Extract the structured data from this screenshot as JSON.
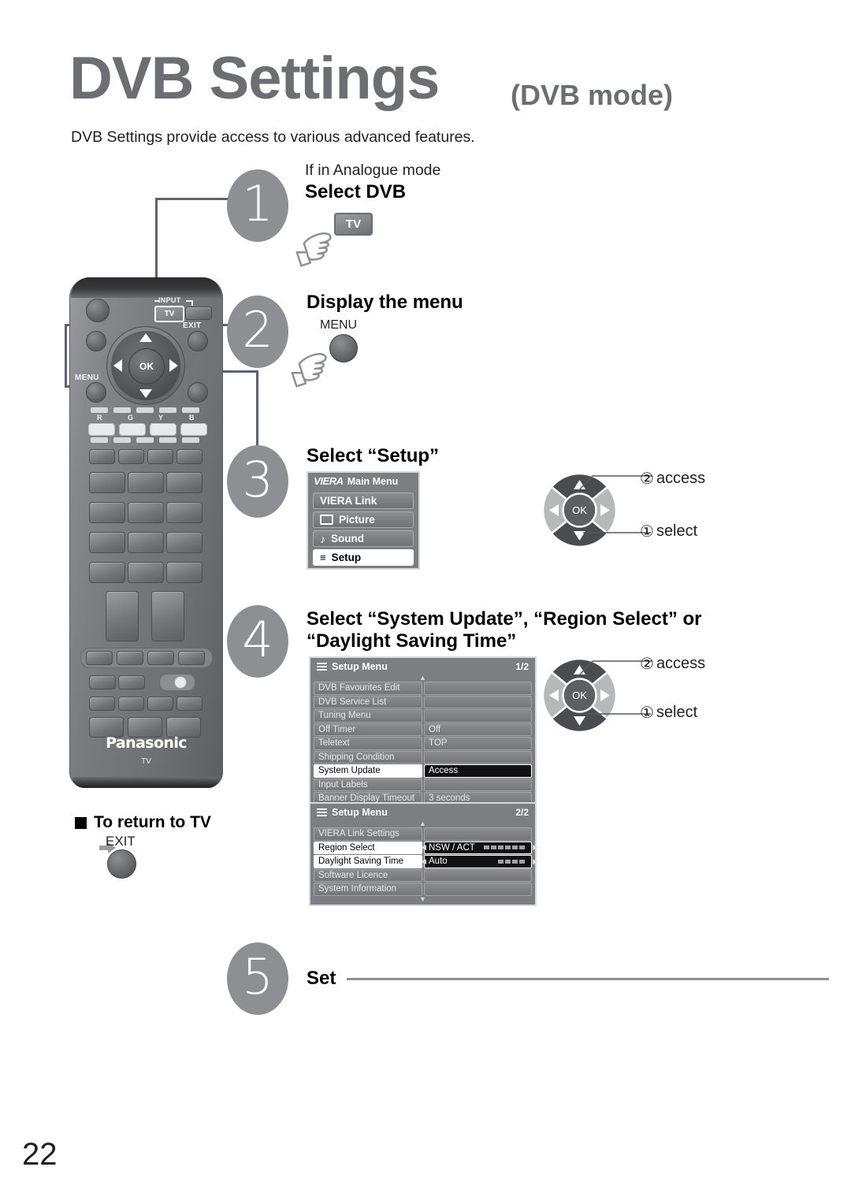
{
  "header": {
    "title": "DVB Settings",
    "subtitle": "(DVB mode)",
    "intro": "DVB Settings provide access to various advanced features."
  },
  "steps": [
    {
      "num": "1",
      "note": "If in Analogue mode",
      "heading": "Select DVB",
      "button_label": "TV"
    },
    {
      "num": "2",
      "note": "",
      "heading": "Display the menu",
      "button_label": "MENU"
    },
    {
      "num": "3",
      "note": "",
      "heading": "Select “Setup”"
    },
    {
      "num": "4",
      "note": "",
      "heading": "Select “System Update”, “Region Select” or “Daylight Saving Time”"
    },
    {
      "num": "5",
      "note": "",
      "heading": "Set"
    }
  ],
  "main_menu": {
    "brand": "VIERA",
    "title": "Main Menu",
    "items": [
      {
        "label": "VIERA Link",
        "icon": "",
        "selected": false
      },
      {
        "label": "Picture",
        "icon": "screen-icon",
        "selected": false
      },
      {
        "label": "Sound",
        "icon": "note-icon",
        "selected": false
      },
      {
        "label": "Setup",
        "icon": "list-icon",
        "selected": true
      }
    ]
  },
  "setup_menu_1": {
    "title": "Setup Menu",
    "page": "1/2",
    "rows": [
      {
        "label": "DVB Favourites Edit",
        "value": "",
        "state": "normal"
      },
      {
        "label": "DVB Service List",
        "value": "",
        "state": "normal"
      },
      {
        "label": "Tuning Menu",
        "value": "",
        "state": "normal"
      },
      {
        "label": "Off Timer",
        "value": "Off",
        "state": "normal"
      },
      {
        "label": "Teletext",
        "value": "TOP",
        "state": "normal"
      },
      {
        "label": "Shipping Condition",
        "value": "",
        "state": "normal"
      },
      {
        "label": "System Update",
        "value": "Access",
        "state": "highlight"
      },
      {
        "label": "Input Labels",
        "value": "",
        "state": "normal"
      },
      {
        "label": "Banner Display Timeout",
        "value": "3 seconds",
        "state": "normal"
      }
    ]
  },
  "setup_menu_2": {
    "title": "Setup Menu",
    "page": "2/2",
    "rows": [
      {
        "label": "VIERA Link Settings",
        "value": "",
        "state": "normal"
      },
      {
        "label": "Region Select",
        "value": "NSW / ACT",
        "state": "adjust",
        "segments": 6
      },
      {
        "label": "Daylight Saving Time",
        "value": "Auto",
        "state": "adjust",
        "segments": 4
      },
      {
        "label": "Software Licence",
        "value": "",
        "state": "normal"
      },
      {
        "label": "System Information",
        "value": "",
        "state": "normal"
      }
    ]
  },
  "navpads": [
    {
      "access_num": "②",
      "access_label": "access",
      "select_num": "①",
      "select_label": "select",
      "ok_label": "OK"
    },
    {
      "access_num": "②",
      "access_label": "access",
      "select_num": "①",
      "select_label": "select",
      "ok_label": "OK"
    }
  ],
  "remote": {
    "brand": "Panasonic",
    "mode_label": "TV",
    "labels": {
      "input": "INPUT",
      "tv": "TV",
      "exit": "EXIT",
      "menu": "MENU",
      "ok": "OK",
      "color_r": "R",
      "color_g": "G",
      "color_y": "Y",
      "color_b": "B"
    }
  },
  "return_to_tv": {
    "heading": "To return to TV",
    "button_label": "EXIT"
  },
  "footer": {
    "page_number": "22"
  },
  "colors": {
    "heading_gray": "#6d6e71",
    "step_circle": "#8e8f92",
    "connector": "#5a6273",
    "osd_bg": "#7c7e82",
    "osd_highlight_bg": "#111111",
    "text": "#231f20"
  }
}
